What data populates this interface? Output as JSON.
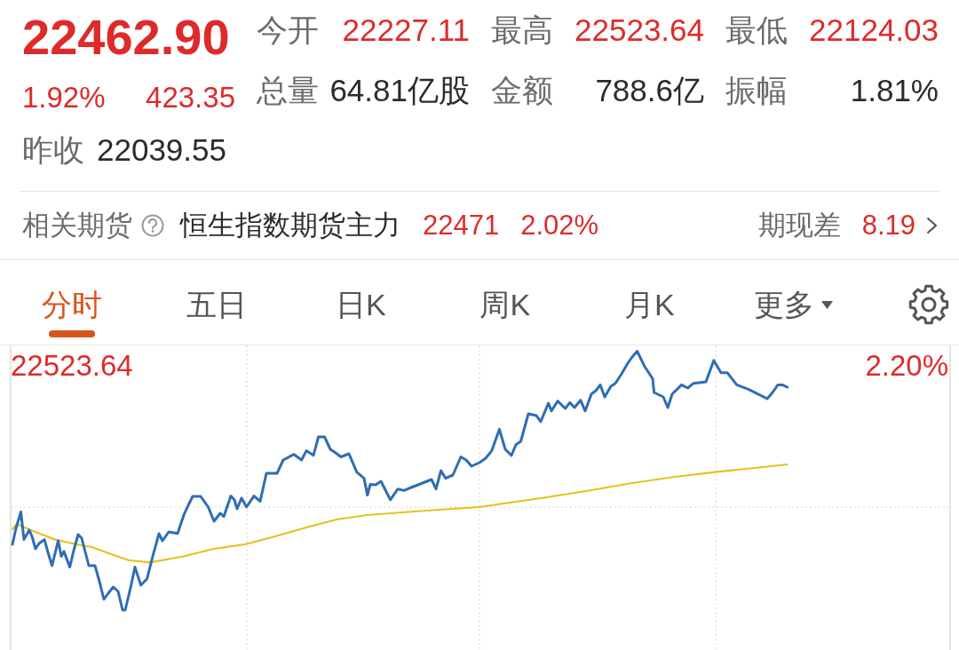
{
  "quote": {
    "price": "22462.90",
    "change_percent": "1.92%",
    "change": "423.35",
    "prev_close": {
      "label": "昨收",
      "value": "22039.55"
    }
  },
  "stats": [
    {
      "label": "今开",
      "value": "22227.11",
      "color": "#dd2b2b"
    },
    {
      "label": "最高",
      "value": "22523.64",
      "color": "#dd2b2b"
    },
    {
      "label": "最低",
      "value": "22124.03",
      "color": "#dd2b2b"
    },
    {
      "label": "总量",
      "value": "64.81亿股",
      "color": "#2b2b2b"
    },
    {
      "label": "金额",
      "value": "788.6亿",
      "color": "#2b2b2b"
    },
    {
      "label": "振幅",
      "value": "1.81%",
      "color": "#2b2b2b"
    }
  ],
  "futures": {
    "label": "相关期货",
    "contract": "恒生指数期货主力",
    "price": "22471",
    "change_percent": "2.02%",
    "basis_label": "期现差",
    "basis": "8.19"
  },
  "tabs": [
    {
      "label": "分时",
      "selected": true,
      "kind": "tab"
    },
    {
      "label": "五日",
      "selected": false,
      "kind": "tab"
    },
    {
      "label": "日K",
      "selected": false,
      "kind": "tab"
    },
    {
      "label": "周K",
      "selected": false,
      "kind": "tab"
    },
    {
      "label": "月K",
      "selected": false,
      "kind": "tab"
    },
    {
      "label": "更多",
      "selected": false,
      "kind": "menu"
    }
  ],
  "chart": {
    "max_price": "22523.64",
    "max_change_percent": "2.20%"
  }
}
